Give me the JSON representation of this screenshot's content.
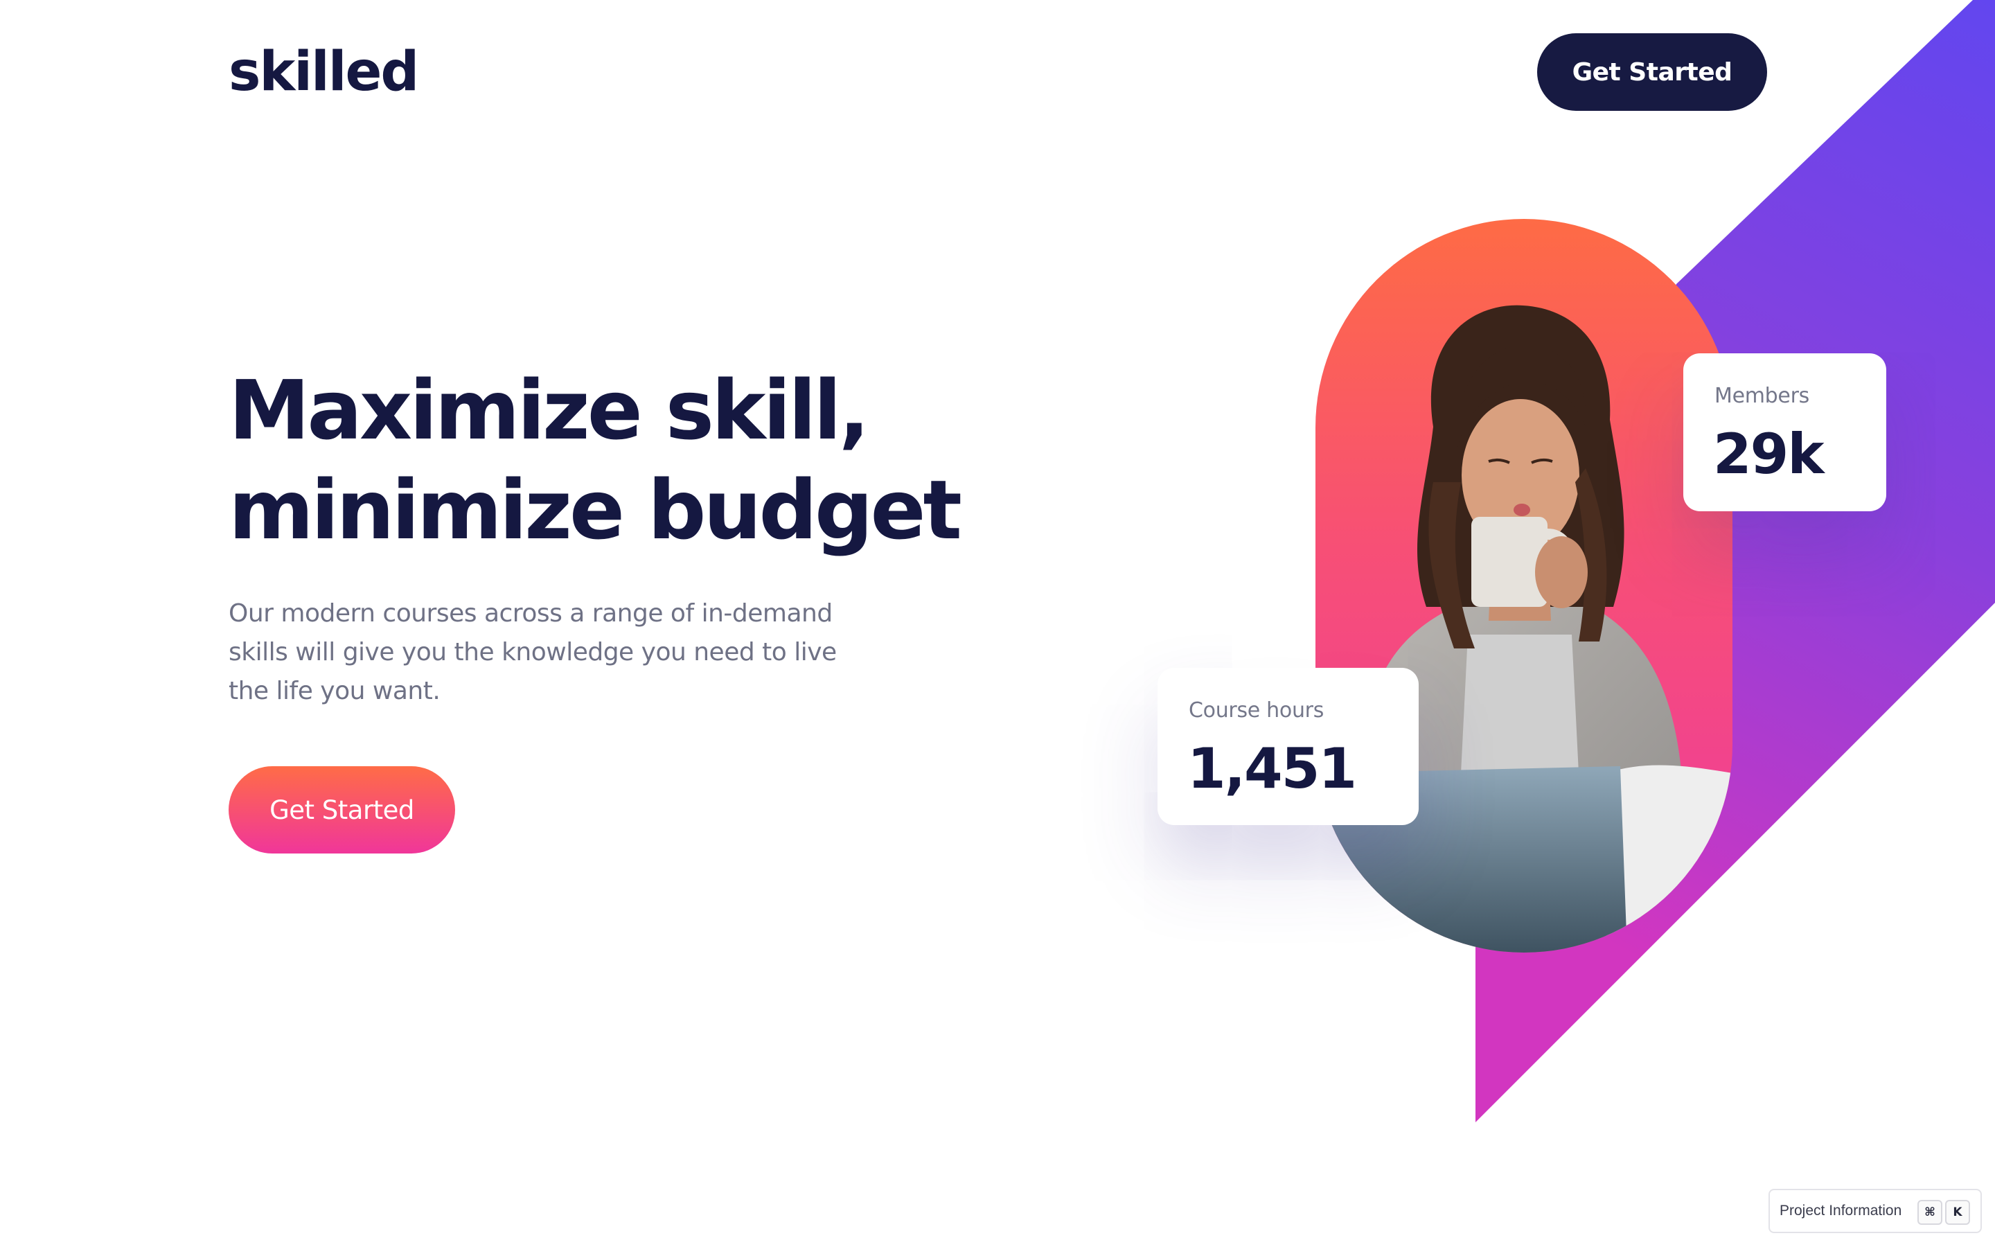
{
  "header": {
    "logo": "skilled",
    "cta_label": "Get Started"
  },
  "hero": {
    "title_line_1": "Maximize skill,",
    "title_line_2": "minimize budget",
    "description": "Our modern courses across a range of in-demand skills will give you the knowledge you need to live the life you want.",
    "cta_label": "Get Started"
  },
  "stats": {
    "members": {
      "label": "Members",
      "value": "29k"
    },
    "course_hours": {
      "label": "Course hours",
      "value": "1,451"
    }
  },
  "footer": {
    "project_info_label": "Project Information",
    "shortcut_keys": [
      "⌘",
      "K"
    ]
  },
  "colors": {
    "navy": "#171a42",
    "text_muted": "#6e7185",
    "gradient_orange": "#ff6c47",
    "gradient_pink": "#f0369a",
    "band_purple": "#6a47ee",
    "band_magenta": "#c43ad0"
  }
}
